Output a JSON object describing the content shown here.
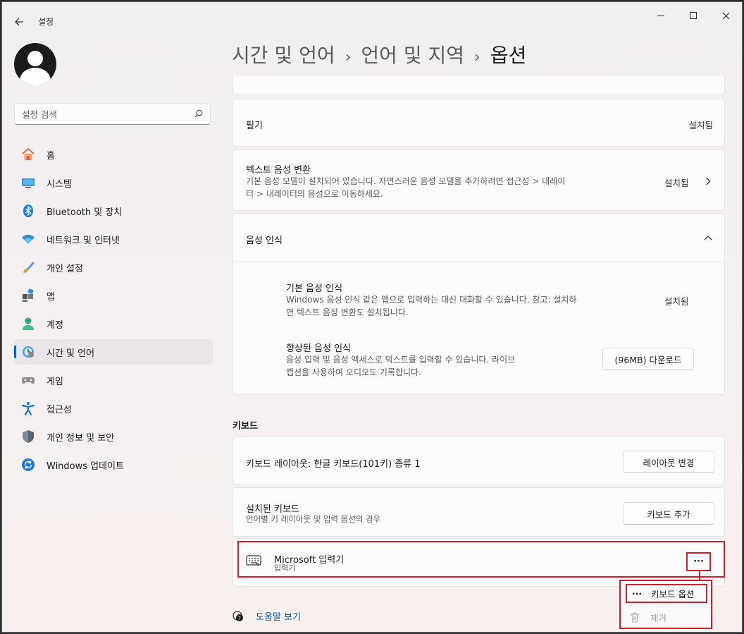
{
  "app": {
    "title": "설정"
  },
  "search": {
    "placeholder": "설정 검색"
  },
  "sidebar": {
    "items": [
      {
        "label": "홈",
        "icon": "home-icon"
      },
      {
        "label": "시스템",
        "icon": "system-icon"
      },
      {
        "label": "Bluetooth 및 장치",
        "icon": "bluetooth-icon"
      },
      {
        "label": "네트워크 및 인터넷",
        "icon": "wifi-icon"
      },
      {
        "label": "개인 설정",
        "icon": "brush-icon"
      },
      {
        "label": "앱",
        "icon": "apps-icon"
      },
      {
        "label": "계정",
        "icon": "account-icon"
      },
      {
        "label": "시간 및 언어",
        "icon": "time-language-icon",
        "active": true
      },
      {
        "label": "게임",
        "icon": "gamepad-icon"
      },
      {
        "label": "접근성",
        "icon": "accessibility-icon"
      },
      {
        "label": "개인 정보 및 보안",
        "icon": "shield-icon"
      },
      {
        "label": "Windows 업데이트",
        "icon": "update-icon"
      }
    ]
  },
  "breadcrumb": {
    "part1": "시간 및 언어",
    "part2": "언어 및 지역",
    "current": "옵션"
  },
  "features": {
    "pen": {
      "title": "필기",
      "status": "설치됨"
    },
    "tts": {
      "title": "텍스트 음성 변환",
      "desc_line1": "기본 음성 모델이 설치되어 있습니다. 자연스러운 음성 모델을 추가하려면 접근성 > 내레이",
      "desc_line2": "터 > 내레이터의 음성으로 이동하세요.",
      "status": "설치됨"
    },
    "speech": {
      "title": "음성 인식",
      "basic": {
        "title": "기본 음성 인식",
        "desc_line1": "Windows 음성 인식 같은 앱으로 입력하는 대신 대화할 수 있습니다. 참고: 설치하",
        "desc_line2": "면 텍스트 음성 변환도 설치됩니다.",
        "status": "설치됨"
      },
      "enhanced": {
        "title": "향상된 음성 인식",
        "desc_line1": "음성 입력 및 음성 액세스로 텍스트를 입력할 수 있습니다. 라이브",
        "desc_line2": "캡션을 사용하여 오디오도 기록합니다.",
        "button": "(96MB) 다운로드"
      }
    }
  },
  "keyboard": {
    "section_title": "키보드",
    "layout": {
      "title": "키보드 레이아웃: 한글 키보드(101키) 종류 1",
      "button": "레이아웃 변경"
    },
    "installed": {
      "title": "설치된 키보드",
      "desc": "언어별 키 레이아웃 및 입력 옵션의 경우",
      "button": "키보드 추가"
    },
    "ms_ime": {
      "title": "Microsoft 입력기",
      "subtitle": "입력기",
      "more": "···"
    }
  },
  "flyout": {
    "options_icon": "···",
    "options_label": "키보드 옵션",
    "remove_label": "제거"
  },
  "help": {
    "label": "도움말 보기"
  },
  "colors": {
    "accent": "#0067c0",
    "highlight": "#d41c2b"
  }
}
